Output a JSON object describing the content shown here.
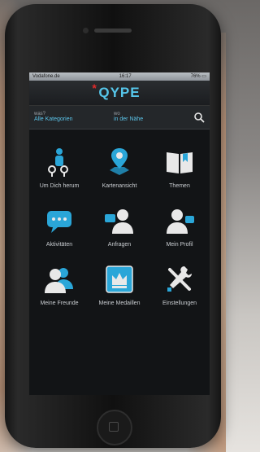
{
  "status_bar": {
    "carrier": "Vodafone.de",
    "time": "16:17",
    "right": "76% ▭"
  },
  "header": {
    "logo_star": "*",
    "logo_text": "QYPE"
  },
  "search": {
    "what_label": "was?",
    "what_value": "Alle Kategorien",
    "where_label": "wo",
    "where_value": "in der Nähe",
    "icon": "search-icon"
  },
  "menu": [
    {
      "label": "Um Dich herum",
      "icon": "person-pins-icon"
    },
    {
      "label": "Kartenansicht",
      "icon": "map-pin-icon"
    },
    {
      "label": "Themen",
      "icon": "open-book-icon"
    },
    {
      "label": "Aktivitäten",
      "icon": "chat-bubble-icon"
    },
    {
      "label": "Anfragen",
      "icon": "user-question-icon"
    },
    {
      "label": "Mein Profil",
      "icon": "user-profile-icon"
    },
    {
      "label": "Meine Freunde",
      "icon": "users-icon"
    },
    {
      "label": "Meine Medaillen",
      "icon": "crown-medal-icon"
    },
    {
      "label": "Einstellungen",
      "icon": "tools-icon"
    }
  ],
  "colors": {
    "accent": "#56c6ea",
    "brand_star": "#e02a2a",
    "background": "#121416"
  }
}
